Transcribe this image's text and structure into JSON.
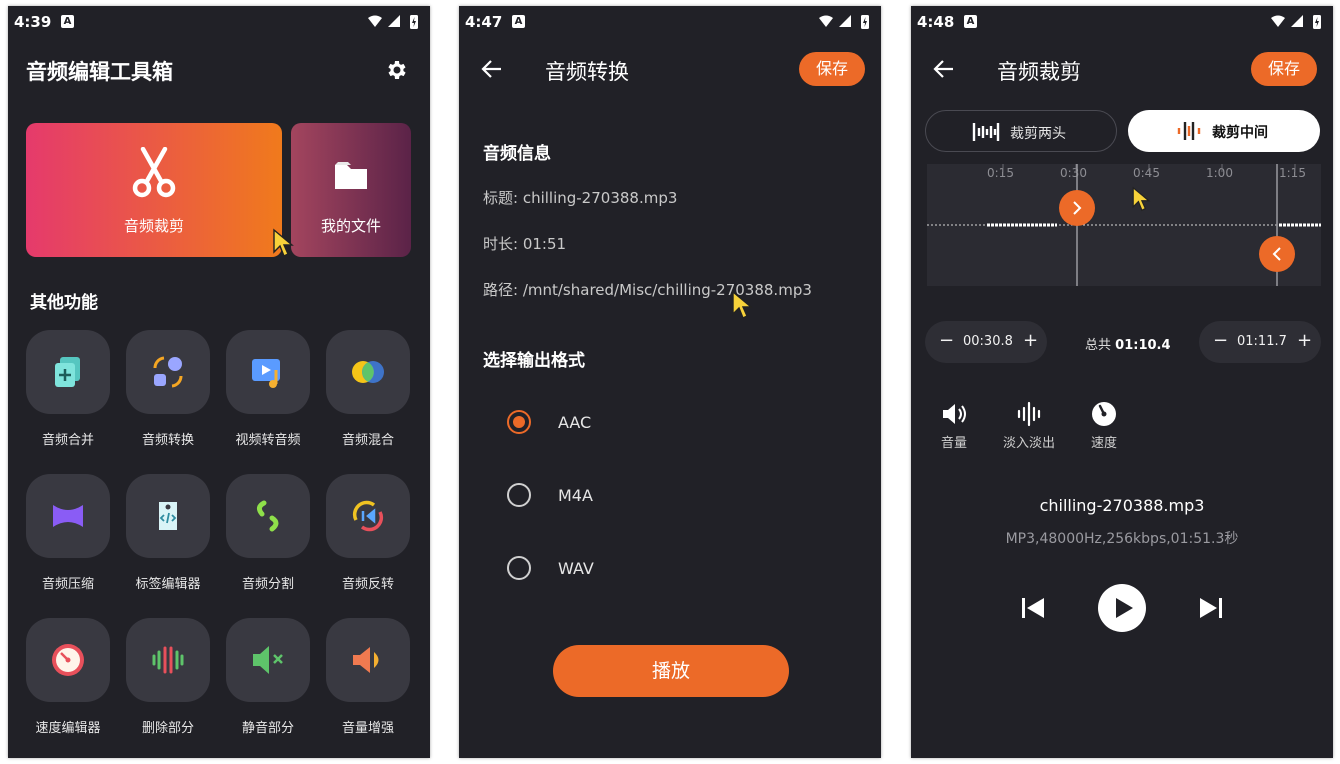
{
  "screen1": {
    "status": {
      "time": "4:39",
      "badge": "A"
    },
    "title": "音频编辑工具箱",
    "cards": {
      "trim": "音频裁剪",
      "files": "我的文件"
    },
    "section_title": "其他功能",
    "tools": [
      {
        "label": "音频合并",
        "icon": "merge-icon"
      },
      {
        "label": "音频转换",
        "icon": "convert-icon"
      },
      {
        "label": "视频转音频",
        "icon": "video-to-audio-icon"
      },
      {
        "label": "音频混合",
        "icon": "mix-icon"
      },
      {
        "label": "音频压缩",
        "icon": "compress-icon"
      },
      {
        "label": "标签编辑器",
        "icon": "tag-icon"
      },
      {
        "label": "音频分割",
        "icon": "split-icon"
      },
      {
        "label": "音频反转",
        "icon": "reverse-icon"
      },
      {
        "label": "速度编辑器",
        "icon": "speed-icon"
      },
      {
        "label": "删除部分",
        "icon": "delete-part-icon"
      },
      {
        "label": "静音部分",
        "icon": "mute-part-icon"
      },
      {
        "label": "音量增强",
        "icon": "volume-boost-icon"
      }
    ]
  },
  "screen2": {
    "status": {
      "time": "4:47",
      "badge": "A"
    },
    "title": "音频转换",
    "save": "保存",
    "info_title": "音频信息",
    "info_name": "标题: chilling-270388.mp3",
    "info_duration": "时长: 01:51",
    "info_path": "路径: /mnt/shared/Misc/chilling-270388.mp3",
    "format_title": "选择输出格式",
    "formats": [
      {
        "label": "AAC",
        "selected": true
      },
      {
        "label": "M4A",
        "selected": false
      },
      {
        "label": "WAV",
        "selected": false
      }
    ],
    "play": "播放"
  },
  "screen3": {
    "status": {
      "time": "4:48",
      "badge": "A"
    },
    "title": "音频裁剪",
    "save": "保存",
    "mode_ends": "裁剪两头",
    "mode_middle": "裁剪中间",
    "ticks": [
      "0:15",
      "0:30",
      "0:45",
      "1:00",
      "1:15"
    ],
    "start_time": "00:30.8",
    "total_label": "总共",
    "total_value": "01:10.4",
    "end_time": "01:11.7",
    "tools": {
      "volume": "音量",
      "fade": "淡入淡出",
      "speed": "速度"
    },
    "file_name": "chilling-270388.mp3",
    "file_meta": "MP3,48000Hz,256kbps,01:51.3秒",
    "start_fraction": 0.27,
    "end_fraction": 0.35
  },
  "colors": {
    "accent": "#ec6a28",
    "background": "#212127",
    "tile": "#393941"
  }
}
